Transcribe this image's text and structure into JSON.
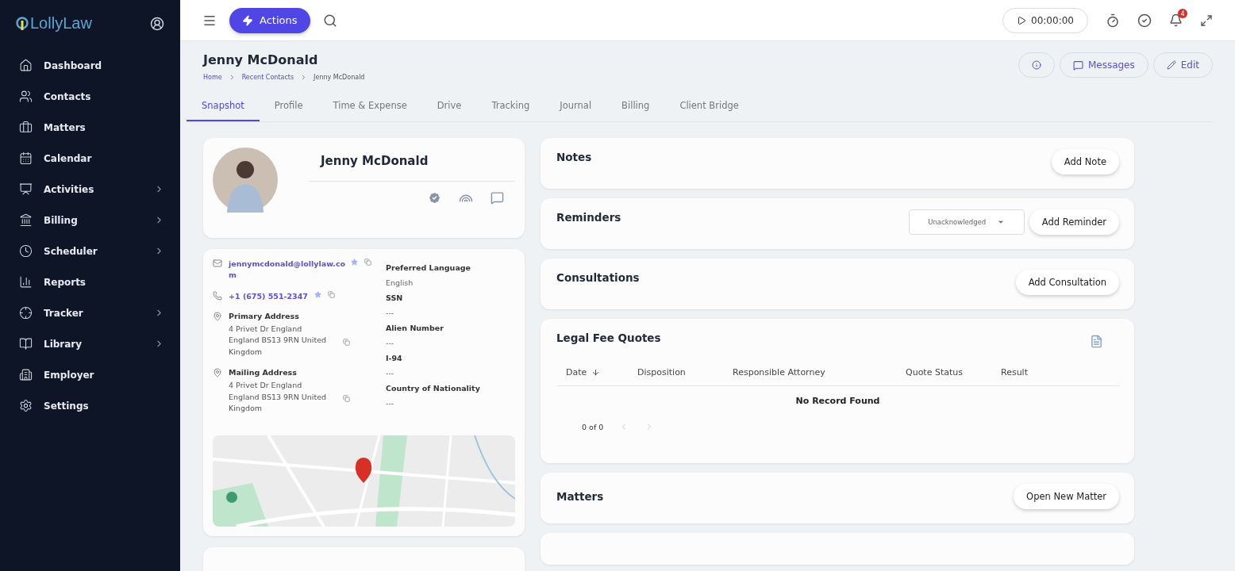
{
  "sidebar": {
    "logo": "LollyLaw",
    "items": [
      {
        "label": "Dashboard",
        "has_submenu": false
      },
      {
        "label": "Contacts",
        "has_submenu": false
      },
      {
        "label": "Matters",
        "has_submenu": false
      },
      {
        "label": "Calendar",
        "has_submenu": false
      },
      {
        "label": "Activities",
        "has_submenu": true
      },
      {
        "label": "Billing",
        "has_submenu": true
      },
      {
        "label": "Scheduler",
        "has_submenu": true
      },
      {
        "label": "Reports",
        "has_submenu": false
      },
      {
        "label": "Tracker",
        "has_submenu": true
      },
      {
        "label": "Library",
        "has_submenu": true
      },
      {
        "label": "Employer",
        "has_submenu": false
      },
      {
        "label": "Settings",
        "has_submenu": false
      }
    ]
  },
  "topbar": {
    "actions_button": "Actions",
    "timer": "00:00:00",
    "notification_count": "4"
  },
  "header": {
    "title": "Jenny McDonald",
    "breadcrumbs": [
      "Home",
      "Recent Contacts",
      "Jenny McDonald"
    ],
    "buttons": [
      "Messages",
      "Edit"
    ]
  },
  "tabs": [
    {
      "label": "Snapshot",
      "selected": true
    },
    {
      "label": "Profile",
      "selected": false
    },
    {
      "label": "Time & Expense",
      "selected": false
    },
    {
      "label": "Drive",
      "selected": false
    },
    {
      "label": "Tracking",
      "selected": false
    },
    {
      "label": "Journal",
      "selected": false
    },
    {
      "label": "Billing",
      "selected": false
    },
    {
      "label": "Client Bridge",
      "selected": false
    }
  ],
  "contact": {
    "name": "Jenny McDonald",
    "verified": true,
    "email": "jennymcdonald@lollylaw.co\nm",
    "phone": "+1 (675) 551-2347",
    "addresses": [
      {
        "label": "Primary Address",
        "value": "4 Privet Dr England\nEngland BS13 9RN United\nKingdom"
      },
      {
        "label": "Mailing Address",
        "value": "4 Privet Dr England\nEngland BS13 9RN United\nKingdom"
      }
    ],
    "fields": [
      {
        "label": "Preferred Language",
        "value": "English"
      },
      {
        "label": "SSN",
        "value": "---"
      },
      {
        "label": "Alien Number",
        "value": "---"
      },
      {
        "label": "I-94",
        "value": "---"
      },
      {
        "label": "Country of Nationality",
        "value": "---"
      }
    ]
  },
  "notes": {
    "title": "Notes",
    "button": "Add Note"
  },
  "reminders": {
    "title": "Reminders",
    "filter": "Unacknowledged",
    "button": "Add Reminder"
  },
  "consultations": {
    "title": "Consultations",
    "button": "Add Consultation"
  },
  "legal_fee_quotes": {
    "title": "Legal Fee Quotes",
    "columns": [
      "Date",
      "Disposition",
      "Responsible Attorney",
      "Quote Status",
      "Result"
    ],
    "empty": "No Record Found",
    "pagination": "0 of 0"
  },
  "matters": {
    "title": "Matters",
    "button": "Open New Matter"
  }
}
